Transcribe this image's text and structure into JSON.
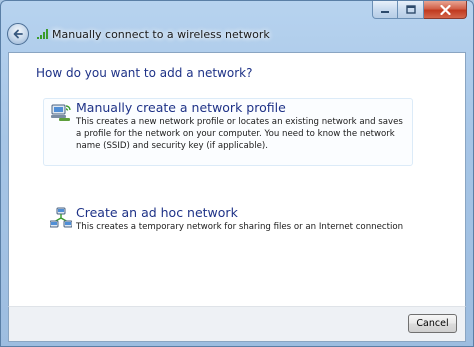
{
  "window": {
    "title": "Manually connect to a wireless network"
  },
  "main": {
    "heading": "How do you want to add a network?",
    "options": [
      {
        "title": "Manually create a network profile",
        "description": "This creates a new network profile or locates an existing network and saves a profile for the network on your computer. You need to know the network name (SSID) and security key (if applicable).",
        "icon": "network-computer-icon",
        "selected": true
      },
      {
        "title": "Create an ad hoc network",
        "description": "This creates a temporary network for sharing files or an Internet connection",
        "icon": "adhoc-network-icon",
        "selected": false
      }
    ]
  },
  "footer": {
    "cancel_label": "Cancel"
  },
  "colors": {
    "heading": "#1e3287",
    "close_button": "#c0391f",
    "selection_border": "#dcebf8"
  }
}
